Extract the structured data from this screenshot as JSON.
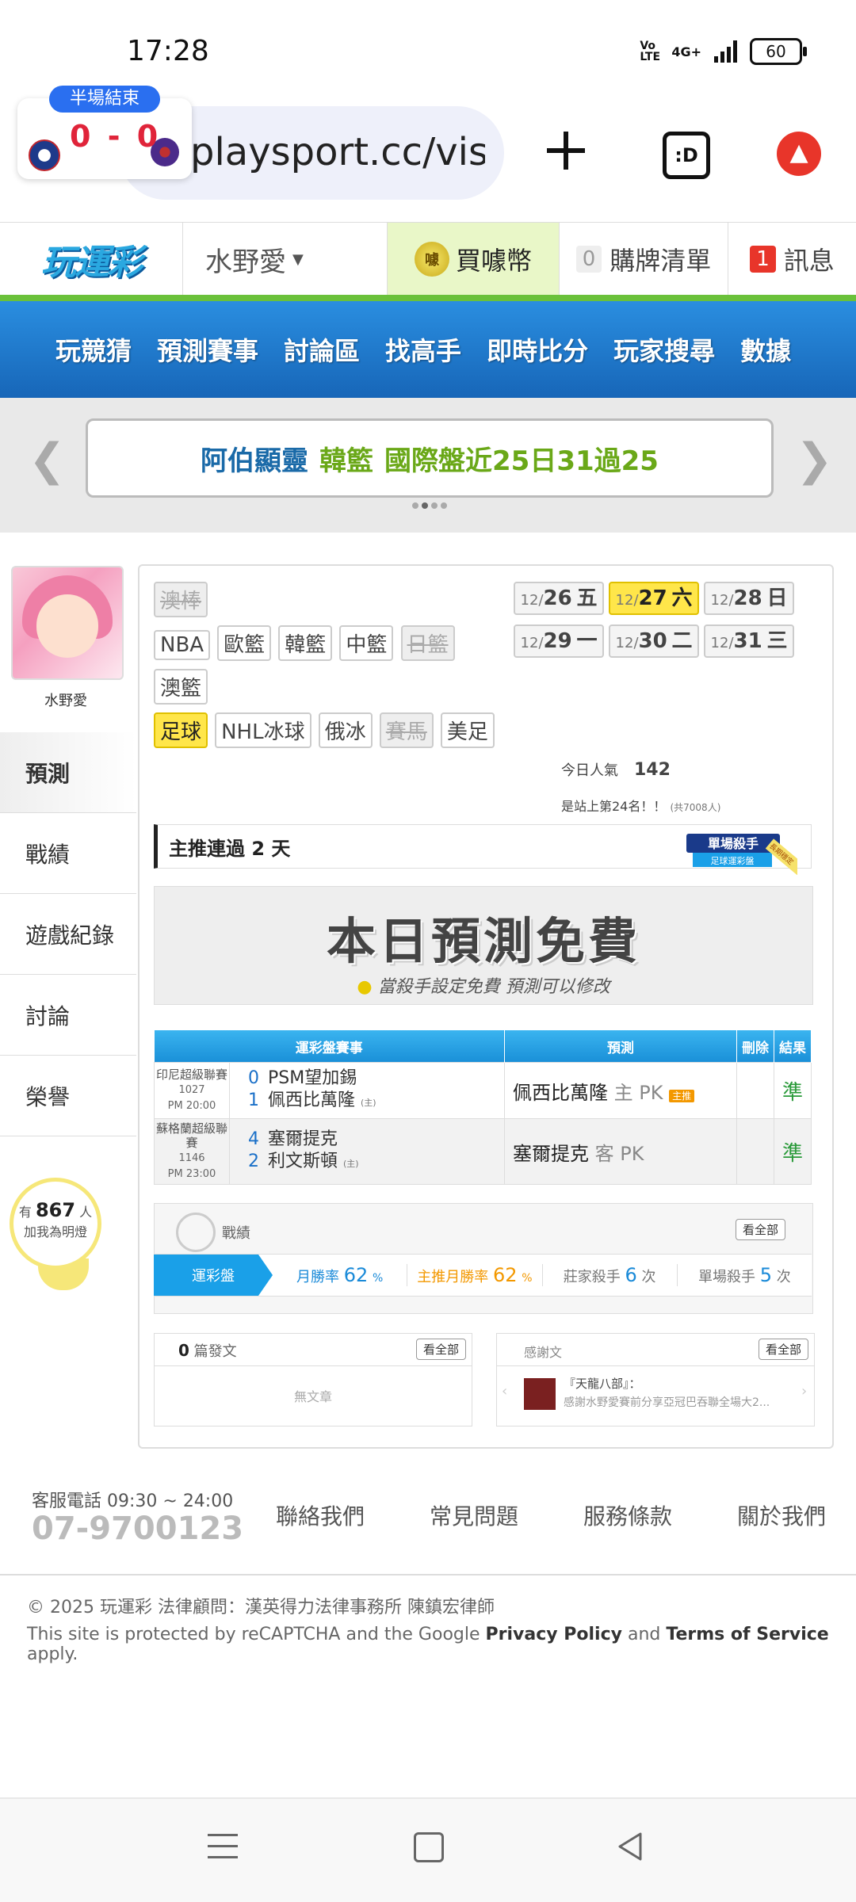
{
  "status_bar": {
    "time": "17:28",
    "volte": "Vo LTE",
    "network": "4G+",
    "battery": "60"
  },
  "browser": {
    "url": "playsport.cc/visit",
    "score": {
      "badge": "半場結束",
      "home": "0",
      "separator": "-",
      "away": "0"
    },
    "tabs_label": ":D"
  },
  "site": {
    "logo": "玩運彩",
    "username": "水野愛",
    "coin_label": "買噱幣",
    "buy_list": {
      "count": "0",
      "label": "購牌清單"
    },
    "messages": {
      "count": "1",
      "label": "訊息"
    },
    "nav": [
      "玩競猜",
      "預測賽事",
      "討論區",
      "找高手",
      "即時比分",
      "玩家搜尋",
      "數據"
    ],
    "banner": {
      "part1": "阿伯顯靈",
      "part2": "韓籃",
      "part3": "國際盤近25日31過25"
    }
  },
  "sidebar": {
    "name": "水野愛",
    "items": [
      "預測",
      "戰績",
      "遊戲紀錄",
      "討論",
      "榮譽"
    ],
    "fans": {
      "prefix": "有",
      "count": "867",
      "suffix": "人",
      "line2": "加我為明燈"
    }
  },
  "leagues": {
    "row1": [
      "澳棒"
    ],
    "row2": [
      "NBA",
      "歐籃",
      "韓籃",
      "中籃",
      "日籃"
    ],
    "row3": [
      "澳籃"
    ],
    "row4": [
      "足球",
      "NHL冰球",
      "俄冰",
      "賽馬",
      "美足"
    ]
  },
  "dates": [
    {
      "month": "12/",
      "day": "26",
      "weekday": "五"
    },
    {
      "month": "12/",
      "day": "27",
      "weekday": "六"
    },
    {
      "month": "12/",
      "day": "28",
      "weekday": "日"
    },
    {
      "month": "12/",
      "day": "29",
      "weekday": "一"
    },
    {
      "month": "12/",
      "day": "30",
      "weekday": "二"
    },
    {
      "month": "12/",
      "day": "31",
      "weekday": "三"
    }
  ],
  "popularity": {
    "label": "今日人氣",
    "value": "142",
    "rank": "是站上第24名！！",
    "total": "(共7008人)"
  },
  "streak": "主推連過 2 天",
  "badge": {
    "line1": "單場殺手",
    "line2": "足球運彩盤",
    "ribbon": "長期穩定"
  },
  "free": {
    "title": "本日預測免費",
    "subtitle": "當殺手設定免費  預測可以修改"
  },
  "table": {
    "headers": [
      "運彩盤賽事",
      "預測",
      "刪除",
      "結果"
    ],
    "rows": [
      {
        "league": "印尼超級聯賽",
        "code": "1027",
        "time": "PM 20:00",
        "score_a": "0",
        "team_a": "PSM望加錫",
        "score_b": "1",
        "team_b": "佩西比萬隆",
        "host": "(主)",
        "pick": "佩西比萬隆",
        "pick_type": "主 PK",
        "pick_tag": "主推",
        "result": "準"
      },
      {
        "league": "蘇格蘭超級聯賽",
        "code": "1146",
        "time": "PM 23:00",
        "score_a": "4",
        "team_a": "塞爾提克",
        "score_b": "2",
        "team_b": "利文斯頓",
        "host": "(主)",
        "pick": "塞爾提克",
        "pick_type": "客 PK",
        "pick_tag": "",
        "result": "準"
      }
    ]
  },
  "record": {
    "title": "戰績",
    "see_all": "看全部",
    "tab": "運彩盤",
    "month_rate": {
      "label": "月勝率",
      "value": "62",
      "unit": "%"
    },
    "main_month_rate": {
      "label": "主推月勝率",
      "value": "62",
      "unit": "%"
    },
    "banker_killer": {
      "label": "莊家殺手",
      "value": "6",
      "unit": "次"
    },
    "single_killer": {
      "label": "單場殺手",
      "value": "5",
      "unit": "次"
    }
  },
  "posts": {
    "count": "0",
    "label": "篇發文",
    "see_all": "看全部",
    "empty": "無文章"
  },
  "thanks": {
    "label": "感謝文",
    "see_all": "看全部",
    "title": "『天龍八部』：",
    "text": "感謝水野愛賽前分享亞冠巴吞聯全場大2..."
  },
  "footer": {
    "hours": "客服電話 09:30 ~ 24:00",
    "phone": "07-9700123",
    "links": [
      "聯絡我們",
      "常見問題",
      "服務條款",
      "關於我們"
    ],
    "copyright": "© 2025 玩運彩 法律顧問：漢英得力法律事務所 陳鎮宏律師",
    "captcha_1": "This site is protected by reCAPTCHA and the Google ",
    "privacy": "Privacy Policy",
    "and": " and ",
    "terms": "Terms of Service",
    "apply": " apply."
  },
  "colors": {
    "accent_blue": "#1a90d8",
    "nav_blue": "#1766b8",
    "win_green": "#2a9a3a",
    "highlight_yellow": "#ffe64a",
    "brand_green": "#6ac13a"
  }
}
